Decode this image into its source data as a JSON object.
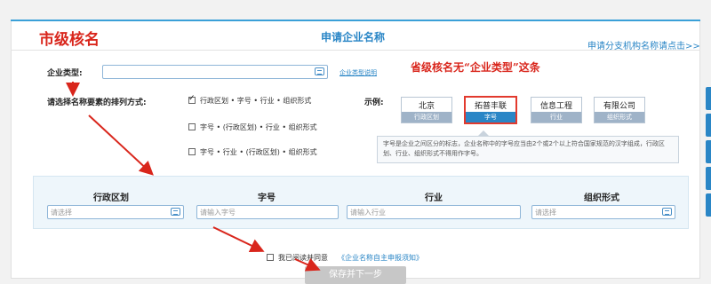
{
  "annotations": {
    "top_left": "市级核名",
    "note": "省级核名无“企业类型”这条"
  },
  "header": {
    "title": "申请企业名称",
    "branch_link": "申请分支机构名称请点击>>"
  },
  "enterprise_type": {
    "label": "企业类型:",
    "value": "",
    "help_link": "企业类型说明"
  },
  "arrangement": {
    "label": "请选择名称要素的排列方式:",
    "options": [
      {
        "label": "行政区划 • 字号 • 行业 • 组织形式",
        "checked": true
      },
      {
        "label": "字号 • (行政区划) • 行业 • 组织形式",
        "checked": false
      },
      {
        "label": "字号 • 行业 • (行政区划) • 组织形式",
        "checked": false
      }
    ]
  },
  "example": {
    "label": "示例:",
    "cards": [
      {
        "title": "北京",
        "subtitle": "行政区划",
        "active": false
      },
      {
        "title": "拓普丰联",
        "subtitle": "字号",
        "active": true
      },
      {
        "title": "信息工程",
        "subtitle": "行业",
        "active": false
      },
      {
        "title": "有限公司",
        "subtitle": "组织形式",
        "active": false
      }
    ],
    "tip": "字号是企业之间区分的标志，企业名称中的字号应当由2个或2个以上符合国家规范的汉字组成，行政区划、行业、组织形式不得用作字号。"
  },
  "name_fields": [
    {
      "header": "行政区划",
      "placeholder": "请选择",
      "has_picker": true
    },
    {
      "header": "字号",
      "placeholder": "请输入字号",
      "has_picker": false
    },
    {
      "header": "行业",
      "placeholder": "请输入行业",
      "has_picker": false
    },
    {
      "header": "组织形式",
      "placeholder": "请选择",
      "has_picker": true
    }
  ],
  "agreement": {
    "checked": false,
    "text": "我已阅读并同意",
    "link": "《企业名称自主申报须知》"
  },
  "submit": {
    "label": "保存并下一步"
  },
  "colors": {
    "accent": "#2a86c6",
    "annotation": "#d9261c",
    "disabled": "#c7c7c7"
  }
}
